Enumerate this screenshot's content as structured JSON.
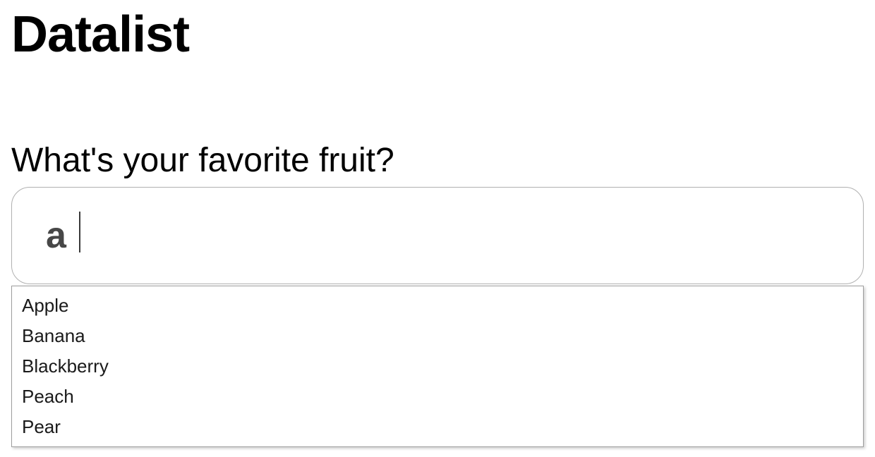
{
  "heading": "Datalist",
  "form": {
    "label": "What's your favorite fruit?",
    "input_value": "a",
    "options": [
      "Apple",
      "Banana",
      "Blackberry",
      "Peach",
      "Pear"
    ]
  }
}
